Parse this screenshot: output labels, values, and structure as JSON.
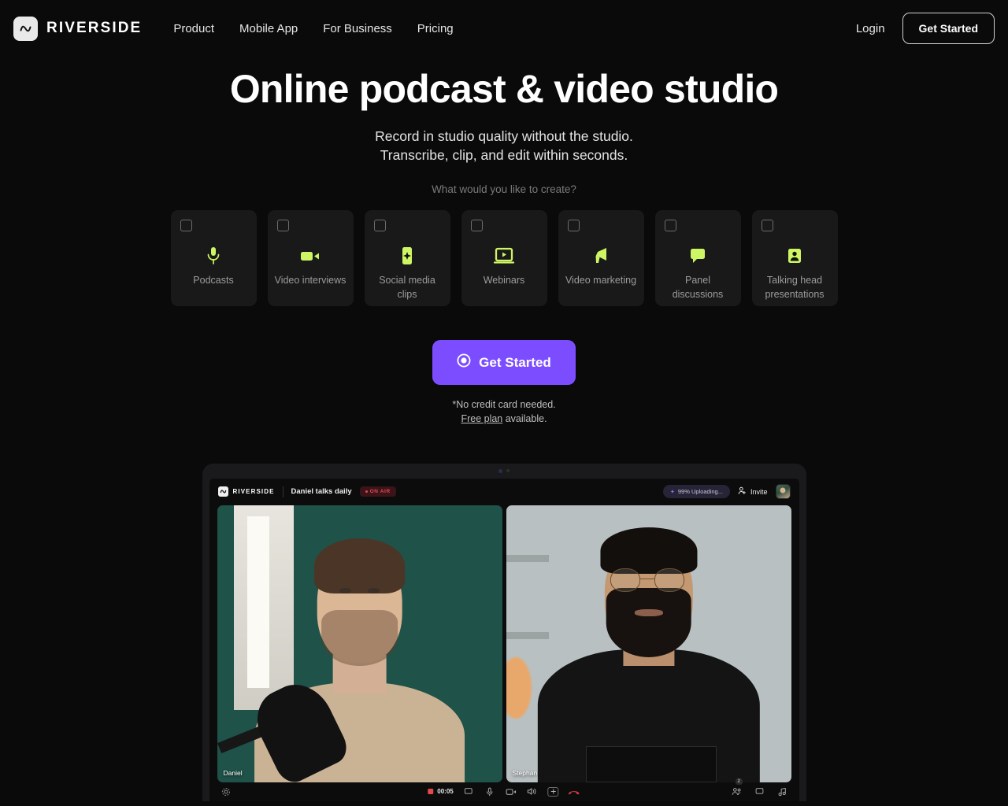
{
  "header": {
    "brand": "RIVERSIDE",
    "nav": [
      {
        "label": "Product"
      },
      {
        "label": "Mobile App"
      },
      {
        "label": "For Business"
      },
      {
        "label": "Pricing"
      }
    ],
    "login_label": "Login",
    "get_started_label": "Get Started"
  },
  "hero": {
    "title": "Online podcast & video studio",
    "sub_line1": "Record in studio quality without the studio.",
    "sub_line2": "Transcribe, clip, and edit within seconds.",
    "question": "What would you like to create?"
  },
  "categories": [
    {
      "label": "Podcasts",
      "icon": "microphone-icon"
    },
    {
      "label": "Video interviews",
      "icon": "video-camera-icon"
    },
    {
      "label": "Social media clips",
      "icon": "sparkle-clip-icon"
    },
    {
      "label": "Webinars",
      "icon": "presentation-play-icon"
    },
    {
      "label": "Video marketing",
      "icon": "megaphone-icon"
    },
    {
      "label": "Panel discussions",
      "icon": "speech-bubble-icon"
    },
    {
      "label": "Talking head presentations",
      "icon": "person-card-icon"
    }
  ],
  "cta": {
    "button_label": "Get Started",
    "note_line1": "*No credit card needed.",
    "note_link": "Free plan",
    "note_tail": " available."
  },
  "app": {
    "brand": "RIVERSIDE",
    "session_title": "Daniel talks daily",
    "on_air": "ON AIR",
    "upload_status": "99% Uploading...",
    "invite_label": "Invite",
    "participants": [
      {
        "name": "Daniel"
      },
      {
        "name": "Stephan"
      }
    ],
    "timer": "00:05",
    "participant_count": "2"
  },
  "colors": {
    "page_bg": "#0a0a0a",
    "accent_purple": "#7c4dff",
    "accent_lime": "#cdf564",
    "card_bg": "#191919",
    "on_air_red": "#e5484d"
  }
}
